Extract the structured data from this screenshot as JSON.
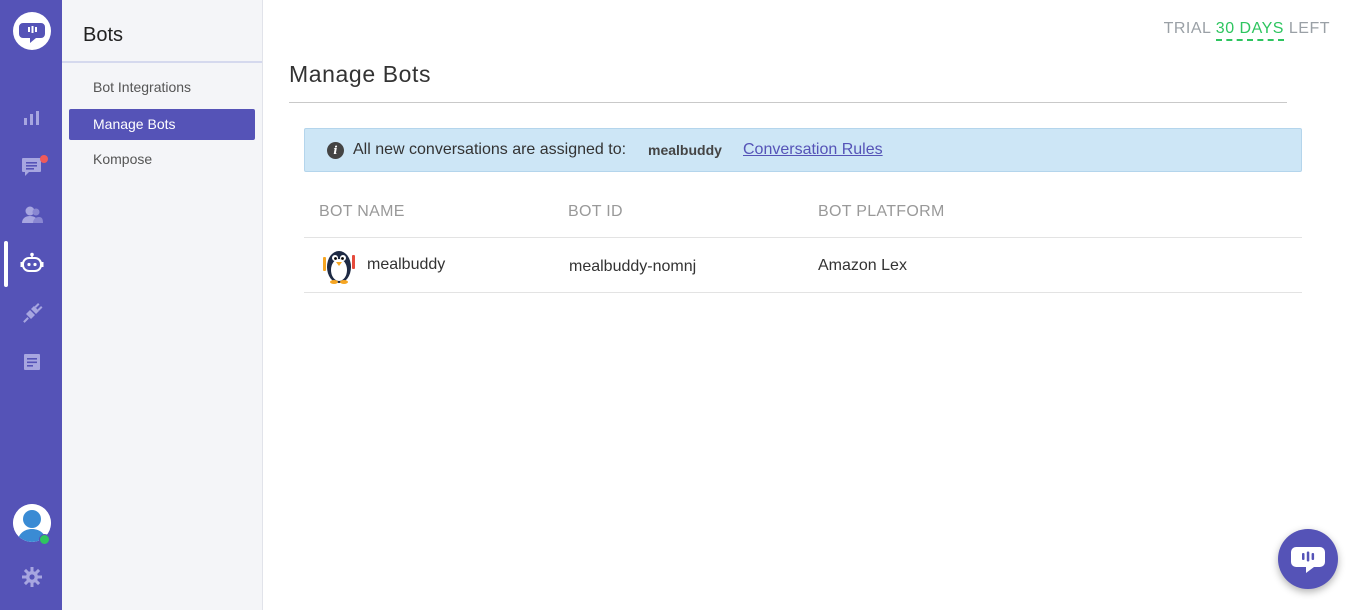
{
  "rail": {
    "icons": [
      "chat-logo-icon",
      "analytics-icon",
      "conversations-icon",
      "users-icon",
      "bot-icon",
      "integrations-icon",
      "reports-icon",
      "settings-icon"
    ],
    "accent_color": "#5553b7",
    "notification_color": "#ef5a5a",
    "online_color": "#2ec55f"
  },
  "sidebar": {
    "title": "Bots",
    "items": [
      {
        "label": "Bot Integrations"
      },
      {
        "label": "Manage Bots",
        "active": true
      },
      {
        "label": "Kompose"
      }
    ]
  },
  "header": {
    "trial_prefix": "TRIAL",
    "trial_days": "30 DAYS",
    "trial_suffix": "LEFT",
    "trial_color": "#2ec55f"
  },
  "main": {
    "title": "Manage Bots",
    "banner": {
      "message": "All new conversations are assigned to:",
      "bot_name": "mealbuddy",
      "link_label": "Conversation Rules"
    },
    "table": {
      "columns": [
        "BOT NAME",
        "BOT ID",
        "BOT PLATFORM"
      ],
      "rows": [
        {
          "name": "mealbuddy",
          "id": "mealbuddy-nomnj",
          "platform": "Amazon Lex"
        }
      ]
    }
  }
}
